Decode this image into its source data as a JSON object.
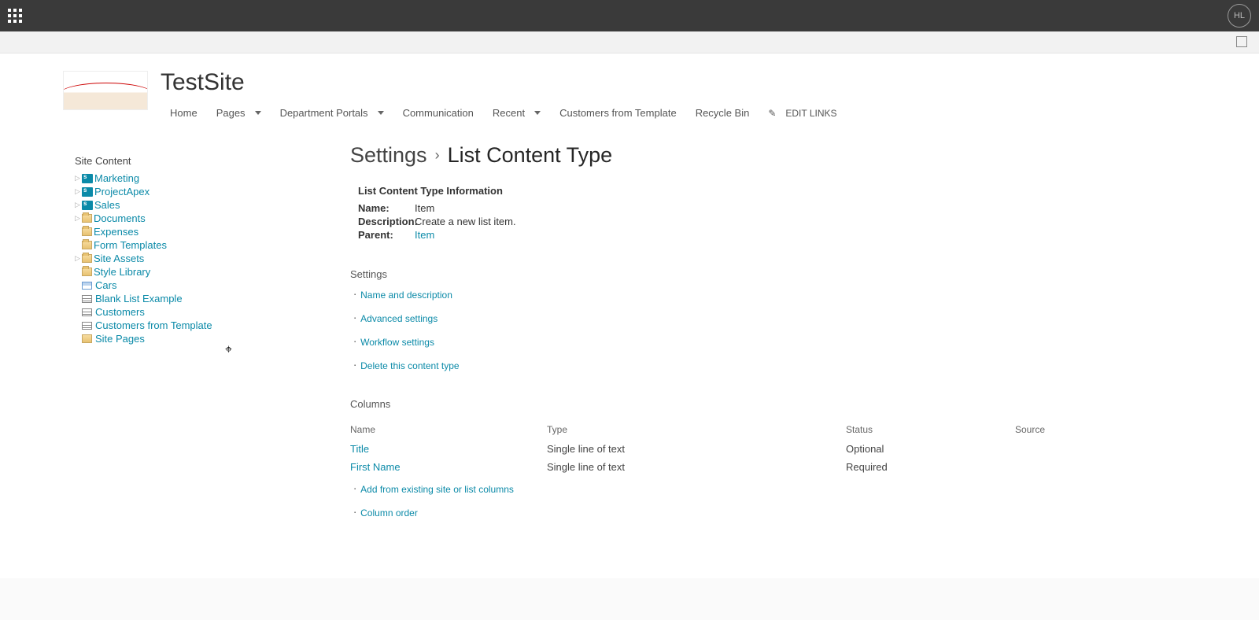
{
  "suite": {
    "user_initials": "HL"
  },
  "site": {
    "title": "TestSite",
    "nav": [
      {
        "label": "Home",
        "has_dropdown": false
      },
      {
        "label": "Pages",
        "has_dropdown": true
      },
      {
        "label": "Department Portals",
        "has_dropdown": true
      },
      {
        "label": "Communication",
        "has_dropdown": false
      },
      {
        "label": "Recent",
        "has_dropdown": true
      },
      {
        "label": "Customers from Template",
        "has_dropdown": false
      },
      {
        "label": "Recycle Bin",
        "has_dropdown": false
      }
    ],
    "edit_links_label": "EDIT LINKS"
  },
  "left_nav": {
    "heading": "Site Content",
    "items": [
      {
        "label": "Marketing",
        "icon": "sub",
        "expander": true
      },
      {
        "label": "ProjectApex",
        "icon": "sub",
        "expander": true
      },
      {
        "label": "Sales",
        "icon": "sub",
        "expander": true
      },
      {
        "label": "Documents",
        "icon": "folder",
        "expander": true
      },
      {
        "label": "Expenses",
        "icon": "folder",
        "expander": false
      },
      {
        "label": "Form Templates",
        "icon": "folder",
        "expander": false
      },
      {
        "label": "Site Assets",
        "icon": "folder",
        "expander": true
      },
      {
        "label": "Style Library",
        "icon": "folder",
        "expander": false
      },
      {
        "label": "Cars",
        "icon": "piclist",
        "expander": false
      },
      {
        "label": "Blank List Example",
        "icon": "list",
        "expander": false
      },
      {
        "label": "Customers",
        "icon": "list",
        "expander": false
      },
      {
        "label": "Customers from Template",
        "icon": "list",
        "expander": false
      },
      {
        "label": "Site Pages",
        "icon": "pages",
        "expander": false
      }
    ]
  },
  "page": {
    "breadcrumb_settings": "Settings",
    "title": "List Content Type",
    "info_heading": "List Content Type Information",
    "info": {
      "name_label": "Name:",
      "name_value": "Item",
      "desc_label": "Description:",
      "desc_value": "Create a new list item.",
      "parent_label": "Parent:",
      "parent_value": "Item"
    },
    "settings_heading": "Settings",
    "settings_links": [
      "Name and description",
      "Advanced settings",
      "Workflow settings",
      "Delete this content type"
    ],
    "columns_heading": "Columns",
    "columns_headers": {
      "name": "Name",
      "type": "Type",
      "status": "Status",
      "source": "Source"
    },
    "columns": [
      {
        "name": "Title",
        "type": "Single line of text",
        "status": "Optional",
        "source": ""
      },
      {
        "name": "First Name",
        "type": "Single line of text",
        "status": "Required",
        "source": ""
      }
    ],
    "column_links": [
      "Add from existing site or list columns",
      "Column order"
    ]
  }
}
